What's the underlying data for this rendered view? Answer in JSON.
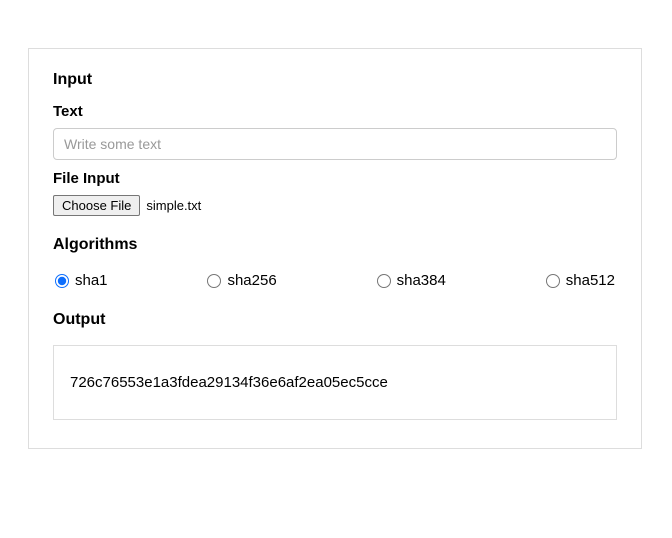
{
  "input": {
    "section_title": "Input",
    "text_label": "Text",
    "text_placeholder": "Write some text",
    "text_value": "",
    "file_label": "File Input",
    "file_button": "Choose File",
    "file_name": "simple.txt"
  },
  "algorithms": {
    "title": "Algorithms",
    "options": [
      {
        "label": "sha1",
        "checked": true
      },
      {
        "label": "sha256",
        "checked": false
      },
      {
        "label": "sha384",
        "checked": false
      },
      {
        "label": "sha512",
        "checked": false
      }
    ]
  },
  "output": {
    "title": "Output",
    "value": "726c76553e1a3fdea29134f36e6af2ea05ec5cce"
  }
}
